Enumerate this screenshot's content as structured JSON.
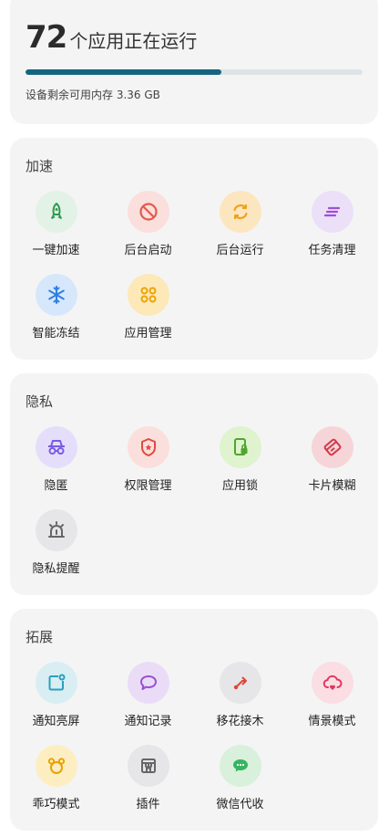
{
  "summary": {
    "count": "72",
    "count_text": "个应用正在运行",
    "memory_text": "设备剩余可用内存 3.36 GB",
    "memory_used_fraction": 0.58
  },
  "sections": {
    "speed": {
      "title": "加速",
      "items": [
        {
          "label": "一键加速",
          "icon": "rocket-icon"
        },
        {
          "label": "后台启动",
          "icon": "block-icon"
        },
        {
          "label": "后台运行",
          "icon": "refresh-icon"
        },
        {
          "label": "任务清理",
          "icon": "clean-icon"
        },
        {
          "label": "智能冻结",
          "icon": "snowflake-icon"
        },
        {
          "label": "应用管理",
          "icon": "apps-grid-icon"
        }
      ]
    },
    "privacy": {
      "title": "隐私",
      "items": [
        {
          "label": "隐匿",
          "icon": "incognito-icon"
        },
        {
          "label": "权限管理",
          "icon": "shield-star-icon"
        },
        {
          "label": "应用锁",
          "icon": "phone-lock-icon"
        },
        {
          "label": "卡片模糊",
          "icon": "card-blur-icon"
        },
        {
          "label": "隐私提醒",
          "icon": "alarm-icon"
        }
      ]
    },
    "ext": {
      "title": "拓展",
      "items": [
        {
          "label": "通知亮屏",
          "icon": "notification-screen-icon"
        },
        {
          "label": "通知记录",
          "icon": "chat-bubble-icon"
        },
        {
          "label": "移花接木",
          "icon": "route-icon"
        },
        {
          "label": "情景模式",
          "icon": "cloud-heart-icon"
        },
        {
          "label": "乖巧模式",
          "icon": "bear-icon"
        },
        {
          "label": "插件",
          "icon": "store-icon"
        },
        {
          "label": "微信代收",
          "icon": "wechat-icon"
        }
      ]
    }
  },
  "colors": {
    "progress_fill": "#15657f",
    "progress_track": "#dde3e6",
    "card_bg": "#f4f4f5"
  }
}
